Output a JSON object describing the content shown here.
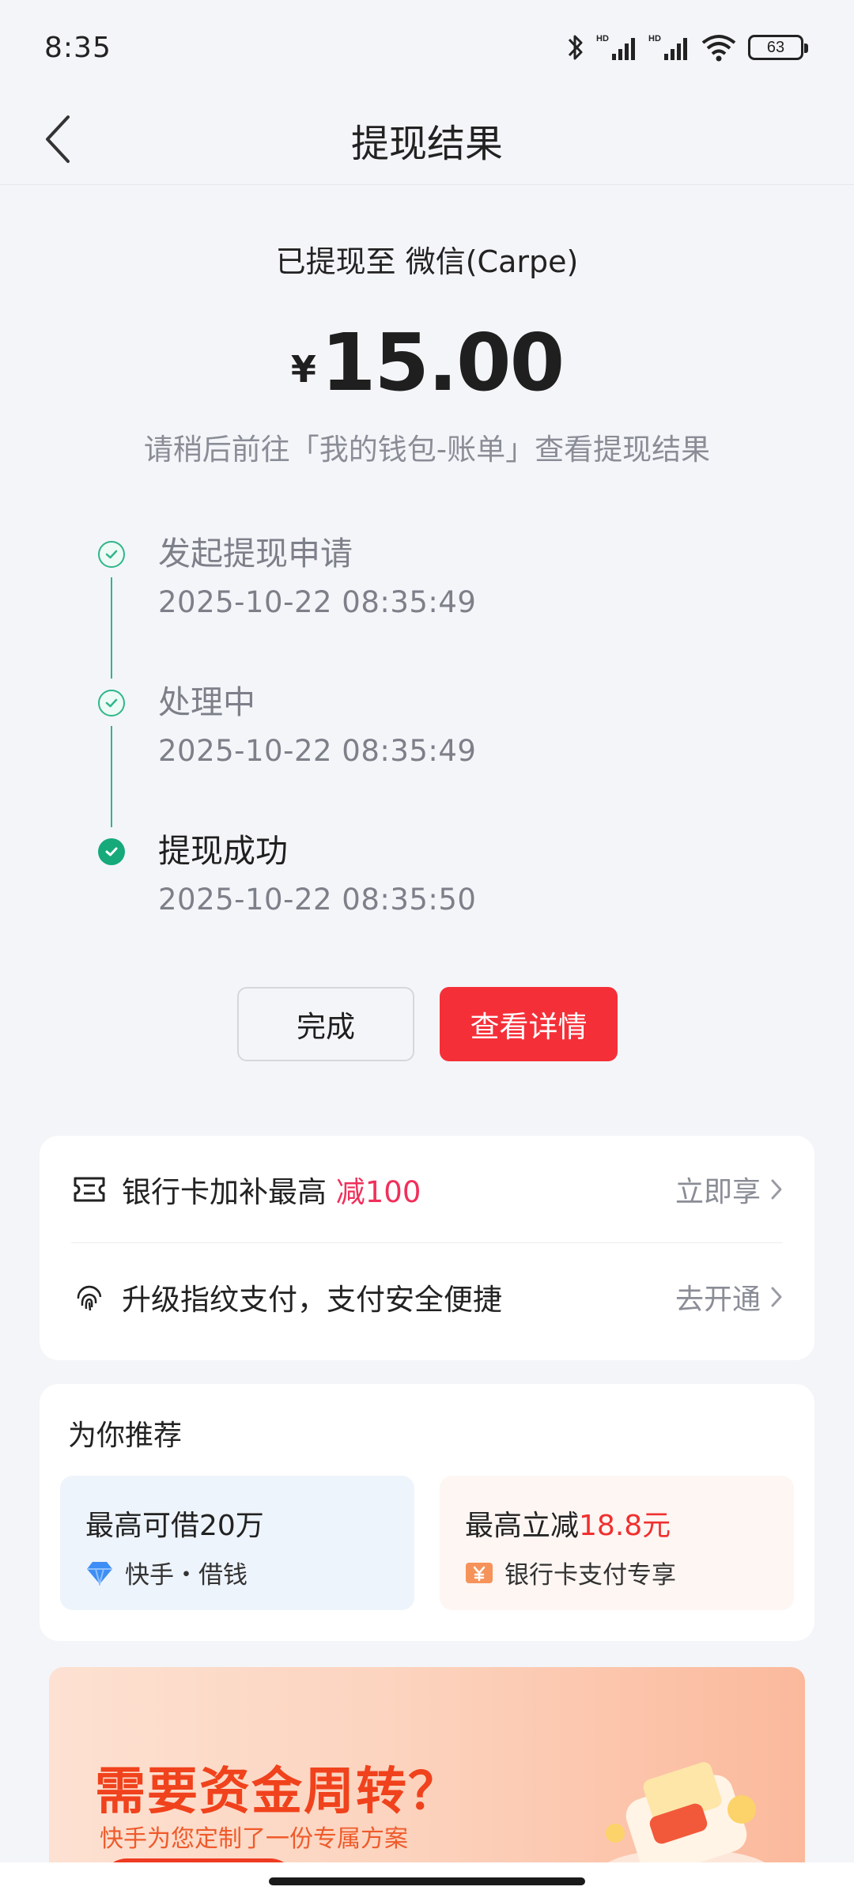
{
  "status_bar": {
    "time": "8:35",
    "battery": "63",
    "icons": [
      "bluetooth-icon",
      "signal-hd-icon",
      "signal-hd-icon",
      "wifi-icon",
      "battery-icon"
    ]
  },
  "nav": {
    "title": "提现结果",
    "back_icon": "chevron-left-icon"
  },
  "result": {
    "destination": "已提现至 微信(Carpe)",
    "currency_symbol": "¥",
    "amount": "15.00",
    "hint": "请稍后前往「我的钱包-账单」查看提现结果"
  },
  "timeline": [
    {
      "title": "发起提现申请",
      "time": "2025-10-22 08:35:49",
      "state": "done"
    },
    {
      "title": "处理中",
      "time": "2025-10-22 08:35:49",
      "state": "done"
    },
    {
      "title": "提现成功",
      "time": "2025-10-22 08:35:50",
      "state": "final"
    }
  ],
  "actions": {
    "done_label": "完成",
    "detail_label": "查看详情"
  },
  "promos": [
    {
      "icon": "ticket-icon",
      "text": "银行卡加补最高 ",
      "highlight": "减100",
      "action": "立即享"
    },
    {
      "icon": "fingerprint-icon",
      "text": "升级指纹支付，支付安全便捷",
      "highlight": "",
      "action": "去开通"
    }
  ],
  "recommend": {
    "title": "为你推荐",
    "tiles": [
      {
        "head": "最高可借20万",
        "head_highlight": "",
        "sub": "快手・借钱",
        "icon": "diamond-icon"
      },
      {
        "head": "最高立减",
        "head_highlight": "18.8元",
        "sub": "银行卡支付专享",
        "icon": "yuan-coupon-icon"
      }
    ]
  },
  "banner": {
    "title": "需要资金周转？",
    "subtitle": "快手为您定制了一份专属方案"
  },
  "colors": {
    "accent_red": "#f52f38",
    "success_green": "#16a97a",
    "highlight_pink": "#f0305a"
  }
}
